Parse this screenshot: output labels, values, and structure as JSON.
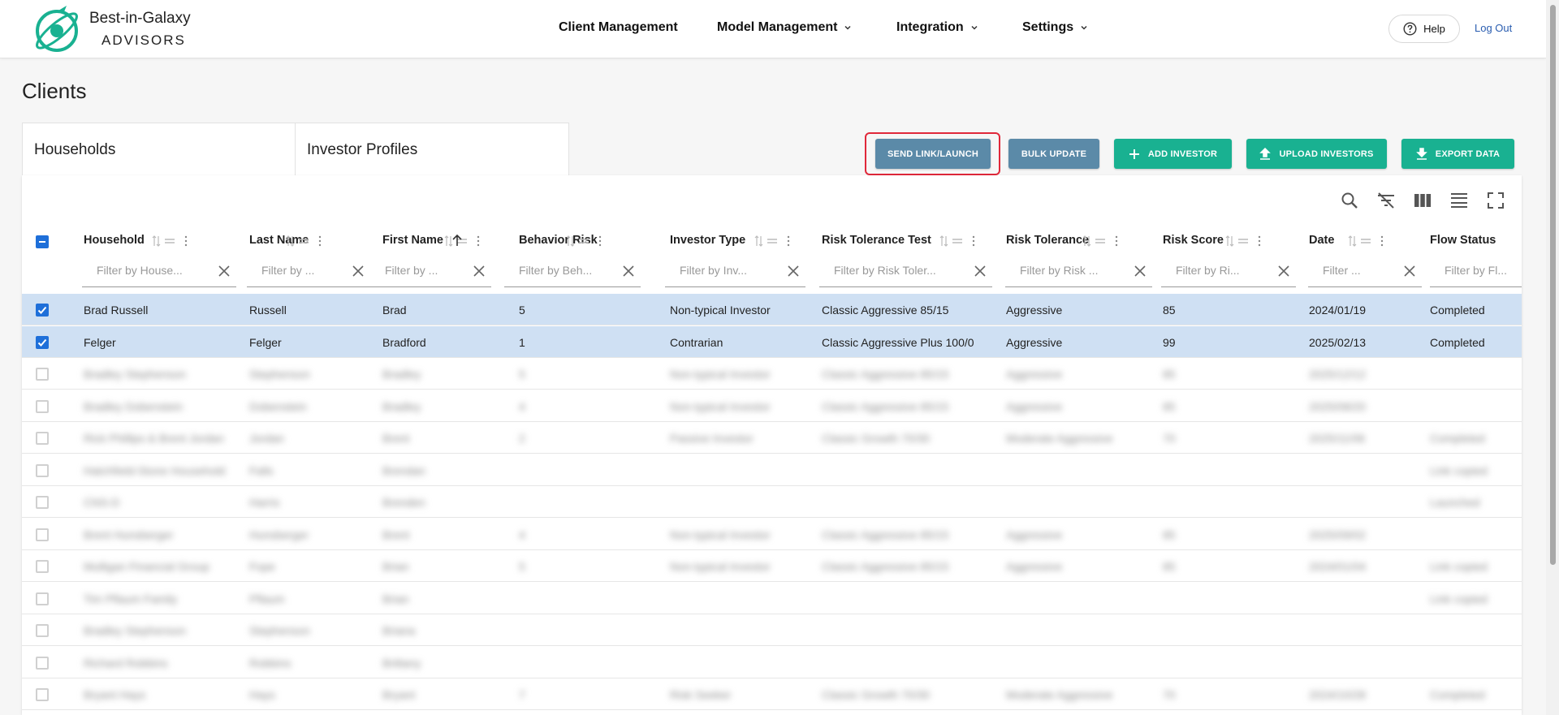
{
  "brand": {
    "line1": "Best-in-Galaxy",
    "line2": "ADVISORS",
    "accent": "#19b191"
  },
  "nav": {
    "client_management": "Client Management",
    "model_management": "Model Management",
    "integration": "Integration",
    "settings": "Settings",
    "help": "Help",
    "logout": "Log Out"
  },
  "page_title": "Clients",
  "tabs": [
    "Households",
    "Investor Profiles"
  ],
  "actions": {
    "send_link": "SEND LINK/LAUNCH",
    "bulk_update": "BULK UPDATE",
    "add_investor": "ADD INVESTOR",
    "upload_investors": "UPLOAD INVESTORS",
    "export_data": "EXPORT DATA"
  },
  "table": {
    "columns": [
      {
        "label": "Household",
        "filter": "Filter by House..."
      },
      {
        "label": "Last Name",
        "filter": "Filter by ..."
      },
      {
        "label": "First Name",
        "filter": "Filter by ..."
      },
      {
        "label": "Behavior Risk",
        "filter": "Filter by Beh..."
      },
      {
        "label": "Investor Type",
        "filter": "Filter by Inv..."
      },
      {
        "label": "Risk Tolerance Test",
        "filter": "Filter by Risk Toler..."
      },
      {
        "label": "Risk Tolerance",
        "filter": "Filter by Risk ..."
      },
      {
        "label": "Risk Score",
        "filter": "Filter by Ri..."
      },
      {
        "label": "Date",
        "filter": "Filter ..."
      },
      {
        "label": "Flow Status",
        "filter": "Filter by Fl..."
      }
    ],
    "rows": [
      {
        "cells": [
          "Brad Russell",
          "Russell",
          "Brad",
          "5",
          "Non-typical Investor",
          "Classic Aggressive 85/15",
          "Aggressive",
          "85",
          "2024/01/19",
          "Completed"
        ]
      },
      {
        "cells": [
          "Felger",
          "Felger",
          "Bradford",
          "1",
          "Contrarian",
          "Classic Aggressive Plus 100/0",
          "Aggressive",
          "99",
          "2025/02/13",
          "Completed"
        ]
      },
      {
        "cells": [
          "Bradley Stephenson",
          "Stephenson",
          "Bradley",
          "5",
          "Non-typical Investor",
          "Classic Aggressive 85/15",
          "Aggressive",
          "85",
          "2025/12/12",
          ""
        ]
      },
      {
        "cells": [
          "Bradley Dobenstein",
          "Dobenstein",
          "Bradley",
          "4",
          "Non-typical Investor",
          "Classic Aggressive 85/15",
          "Aggressive",
          "85",
          "2025/08/20",
          ""
        ]
      },
      {
        "cells": [
          "Rick Phillips & Brent Jordan",
          "Jordan",
          "Brent",
          "2",
          "Passive Investor",
          "Classic Growth 70/30",
          "Moderate Aggressive",
          "70",
          "2025/11/06",
          "Completed"
        ]
      },
      {
        "cells": [
          "Hatchfield-Stone Household",
          "Falls",
          "Brendan",
          "",
          "",
          "",
          "",
          "",
          "",
          "Link copied"
        ]
      },
      {
        "cells": [
          "CNS-D",
          "Harris",
          "Brenden",
          "",
          "",
          "",
          "",
          "",
          "",
          "Launched"
        ]
      },
      {
        "cells": [
          "Brent Hunsberger",
          "Hunsberger",
          "Brent",
          "4",
          "Non-typical Investor",
          "Classic Aggressive 85/15",
          "Aggressive",
          "85",
          "2025/09/02",
          ""
        ]
      },
      {
        "cells": [
          "Mulligan Financial Group",
          "Fope",
          "Brian",
          "5",
          "Non-typical Investor",
          "Classic Aggressive 85/15",
          "Aggressive",
          "85",
          "2024/01/04",
          "Link copied"
        ]
      },
      {
        "cells": [
          "Tim Pflaum Family",
          "Pflaum",
          "Brian",
          "",
          "",
          "",
          "",
          "",
          "",
          "Link copied"
        ]
      },
      {
        "cells": [
          "Bradley Stephenson",
          "Stephenson",
          "Briana",
          "",
          "",
          "",
          "",
          "",
          "",
          ""
        ]
      },
      {
        "cells": [
          "Richard Robbins",
          "Robbins",
          "Brittany",
          "",
          "",
          "",
          "",
          "",
          "",
          ""
        ]
      },
      {
        "cells": [
          "Bryant Hays",
          "Hays",
          "Bryant",
          "7",
          "Risk Seeker",
          "Classic Growth 70/30",
          "Moderate Aggressive",
          "70",
          "2024/10/28",
          "Completed"
        ]
      }
    ]
  }
}
